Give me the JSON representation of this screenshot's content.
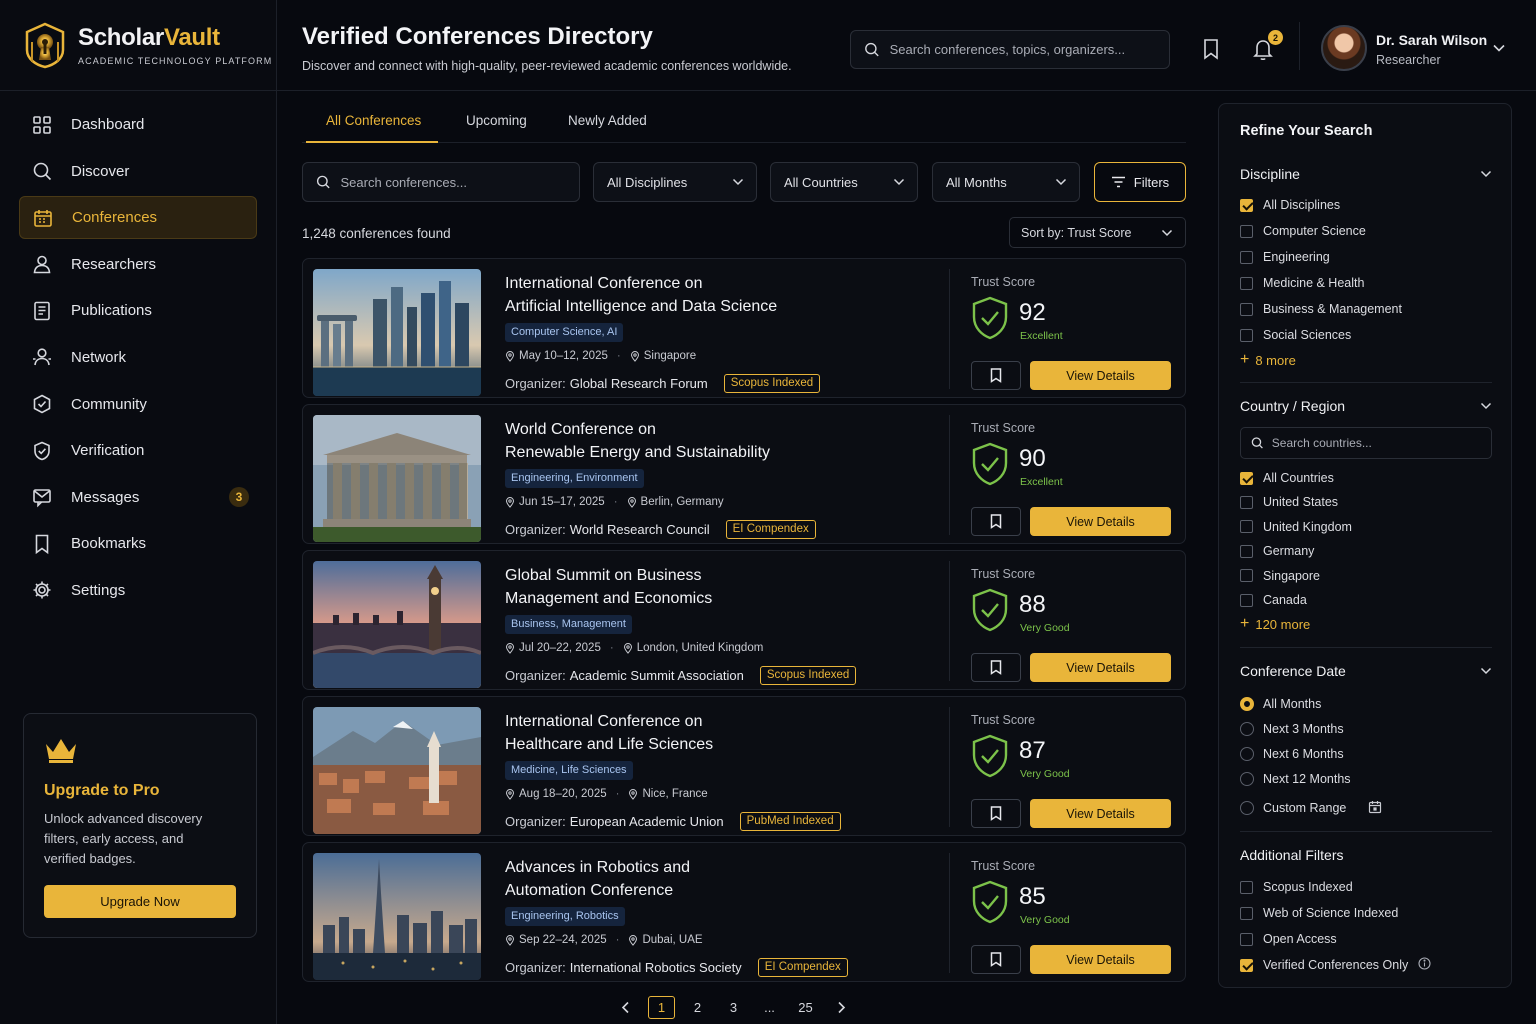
{
  "brand": {
    "name_part1": "Scholar",
    "name_part2": "Vault",
    "subtitle": "ACADEMIC TECHNOLOGY PLATFORM"
  },
  "nav": [
    {
      "label": "Dashboard",
      "icon": "grid-icon"
    },
    {
      "label": "Discover",
      "icon": "search-icon"
    },
    {
      "label": "Conferences",
      "icon": "calendar-icon",
      "active": true
    },
    {
      "label": "Researchers",
      "icon": "user-icon"
    },
    {
      "label": "Publications",
      "icon": "document-icon"
    },
    {
      "label": "Network",
      "icon": "network-icon"
    },
    {
      "label": "Community",
      "icon": "community-icon"
    },
    {
      "label": "Verification",
      "icon": "shield-check-icon"
    },
    {
      "label": "Messages",
      "icon": "message-icon",
      "badge": "3"
    },
    {
      "label": "Bookmarks",
      "icon": "bookmark-icon"
    },
    {
      "label": "Settings",
      "icon": "gear-icon"
    }
  ],
  "upgrade": {
    "title": "Upgrade to Pro",
    "text": "Unlock advanced discovery filters, early access, and verified badges.",
    "button": "Upgrade Now"
  },
  "header": {
    "title": "Verified Conferences Directory",
    "subtitle": "Discover and connect with high-quality, peer-reviewed academic conferences worldwide.",
    "search_placeholder": "Search conferences, topics, organizers...",
    "notification_count": "2",
    "user_name": "Dr. Sarah Wilson",
    "user_role": "Researcher"
  },
  "tabs": [
    "All Conferences",
    "Upcoming",
    "Newly Added"
  ],
  "filters": {
    "search_placeholder": "Search conferences...",
    "discipline": "All Disciplines",
    "country": "All Countries",
    "month": "All Months",
    "button": "Filters"
  },
  "results": {
    "count_text": "1,248 conferences found",
    "sort": "Sort by: Trust Score"
  },
  "cards": [
    {
      "title_line1": "International Conference on",
      "title_line2": "Artificial Intelligence and Data Science",
      "tag": "Computer Science, AI",
      "date": "May 10–12, 2025",
      "location": "Singapore",
      "organizer_label": "Organizer:",
      "organizer": "Global Research Forum",
      "index_badge": "Scopus Indexed",
      "trust_label": "Trust Score",
      "score": "92",
      "grade": "Excellent",
      "button": "View Details"
    },
    {
      "title_line1": "World Conference on",
      "title_line2": "Renewable Energy and Sustainability",
      "tag": "Engineering, Environment",
      "date": "Jun 15–17, 2025",
      "location": "Berlin, Germany",
      "organizer_label": "Organizer:",
      "organizer": "World Research Council",
      "index_badge": "EI Compendex",
      "trust_label": "Trust Score",
      "score": "90",
      "grade": "Excellent",
      "button": "View Details"
    },
    {
      "title_line1": "Global Summit on Business",
      "title_line2": "Management and Economics",
      "tag": "Business, Management",
      "date": "Jul 20–22, 2025",
      "location": "London, United Kingdom",
      "organizer_label": "Organizer:",
      "organizer": "Academic Summit Association",
      "index_badge": "Scopus Indexed",
      "trust_label": "Trust Score",
      "score": "88",
      "grade": "Very Good",
      "button": "View Details"
    },
    {
      "title_line1": "International Conference on",
      "title_line2": "Healthcare and Life Sciences",
      "tag": "Medicine, Life Sciences",
      "date": "Aug 18–20, 2025",
      "location": "Nice, France",
      "organizer_label": "Organizer:",
      "organizer": "European Academic Union",
      "index_badge": "PubMed Indexed",
      "trust_label": "Trust Score",
      "score": "87",
      "grade": "Very Good",
      "button": "View Details"
    },
    {
      "title_line1": "Advances in Robotics and",
      "title_line2": "Automation Conference",
      "tag": "Engineering, Robotics",
      "date": "Sep 22–24, 2025",
      "location": "Dubai, UAE",
      "organizer_label": "Organizer:",
      "organizer": "International Robotics Society",
      "index_badge": "EI Compendex",
      "trust_label": "Trust Score",
      "score": "85",
      "grade": "Very Good",
      "button": "View Details"
    }
  ],
  "pagination": {
    "pages": [
      "1",
      "2",
      "3",
      "...",
      "25"
    ],
    "current": "1"
  },
  "panel": {
    "title": "Refine Your Search",
    "discipline": {
      "title": "Discipline",
      "options": [
        {
          "label": "All Disciplines",
          "checked": true
        },
        {
          "label": "Computer Science",
          "checked": false
        },
        {
          "label": "Engineering",
          "checked": false
        },
        {
          "label": "Medicine & Health",
          "checked": false
        },
        {
          "label": "Business & Management",
          "checked": false
        },
        {
          "label": "Social Sciences",
          "checked": false
        }
      ],
      "more": "8 more"
    },
    "country": {
      "title": "Country / Region",
      "search_placeholder": "Search countries...",
      "options": [
        {
          "label": "All Countries",
          "checked": true
        },
        {
          "label": "United States",
          "checked": false
        },
        {
          "label": "United Kingdom",
          "checked": false
        },
        {
          "label": "Germany",
          "checked": false
        },
        {
          "label": "Singapore",
          "checked": false
        },
        {
          "label": "Canada",
          "checked": false
        }
      ],
      "more": "120 more"
    },
    "date": {
      "title": "Conference Date",
      "options": [
        {
          "label": "All Months",
          "selected": true
        },
        {
          "label": "Next 3 Months",
          "selected": false
        },
        {
          "label": "Next 6 Months",
          "selected": false
        },
        {
          "label": "Next 12 Months",
          "selected": false
        },
        {
          "label": "Custom Range",
          "selected": false
        }
      ]
    },
    "additional": {
      "title": "Additional Filters",
      "options": [
        {
          "label": "Scopus Indexed",
          "checked": false
        },
        {
          "label": "Web of Science Indexed",
          "checked": false
        },
        {
          "label": "Open Access",
          "checked": false
        },
        {
          "label": "Verified Conferences Only",
          "checked": true
        }
      ]
    }
  },
  "colors": {
    "accent": "#e9b53a",
    "success": "#7cc24a",
    "background": "#07090f"
  }
}
